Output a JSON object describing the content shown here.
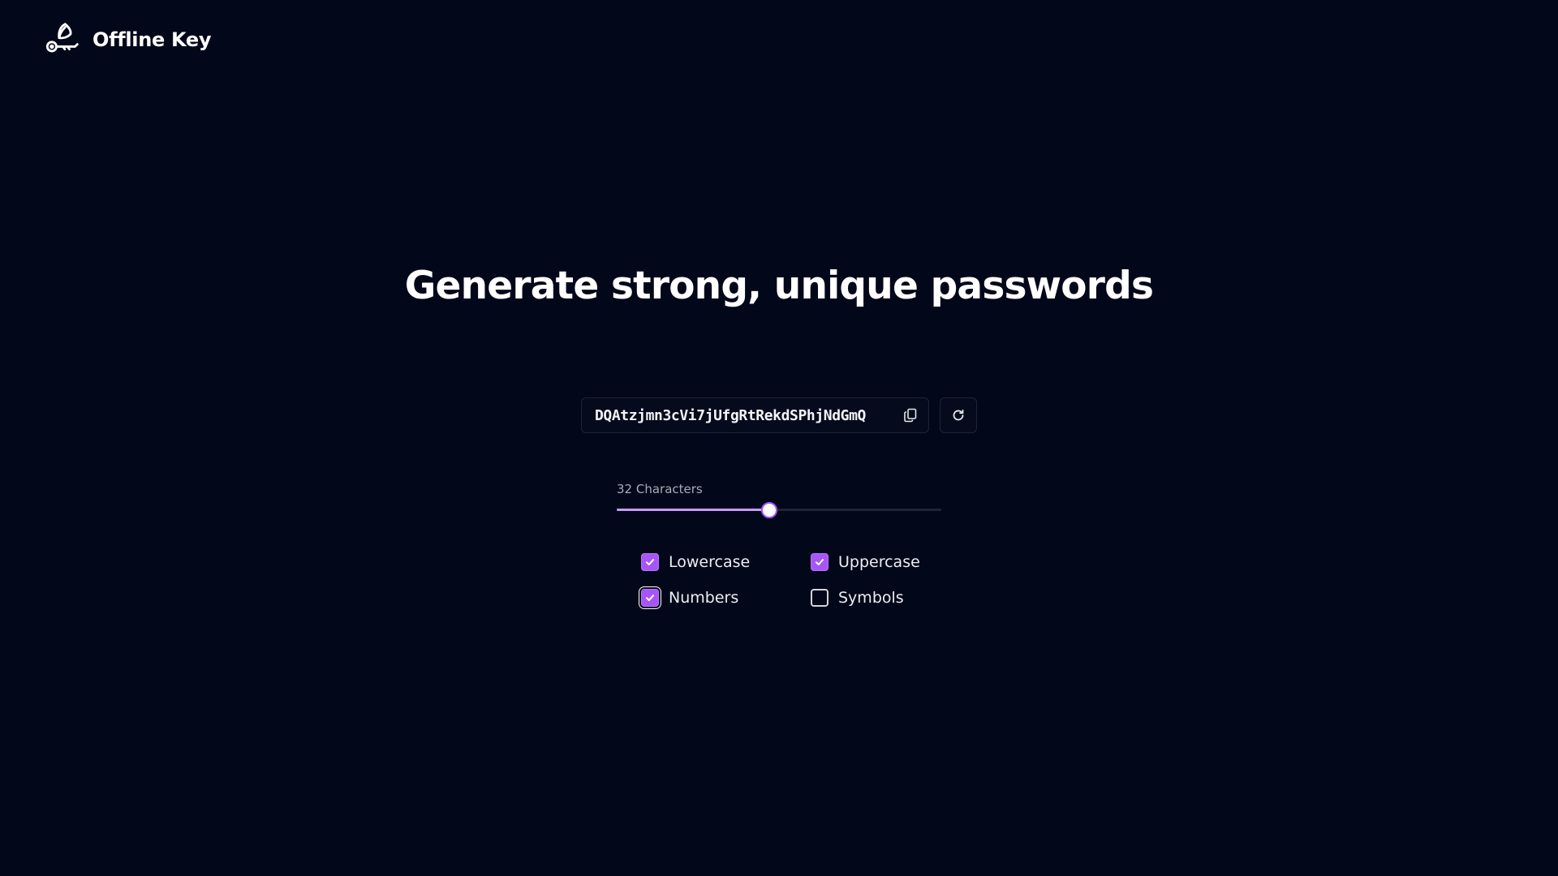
{
  "app": {
    "name": "Offline Key",
    "logo_icon": "key-feather-icon"
  },
  "hero": {
    "title": "Generate strong, unique passwords"
  },
  "generator": {
    "password": "DQAtzjmn3cVi7jUfgRtRekdSPhjNdGmQ",
    "copy_icon": "copy-icon",
    "regenerate_icon": "refresh-icon"
  },
  "length": {
    "label": "32 Characters",
    "value": 32,
    "fill_fraction": 0.47
  },
  "options": [
    {
      "label": "Lowercase",
      "checked": true
    },
    {
      "label": "Uppercase",
      "checked": true
    },
    {
      "label": "Numbers",
      "checked": true
    },
    {
      "label": "Symbols",
      "checked": false
    }
  ],
  "colors": {
    "background": "#03071a",
    "accent": "#a855f7",
    "slider_fill": "#c69cf8"
  }
}
